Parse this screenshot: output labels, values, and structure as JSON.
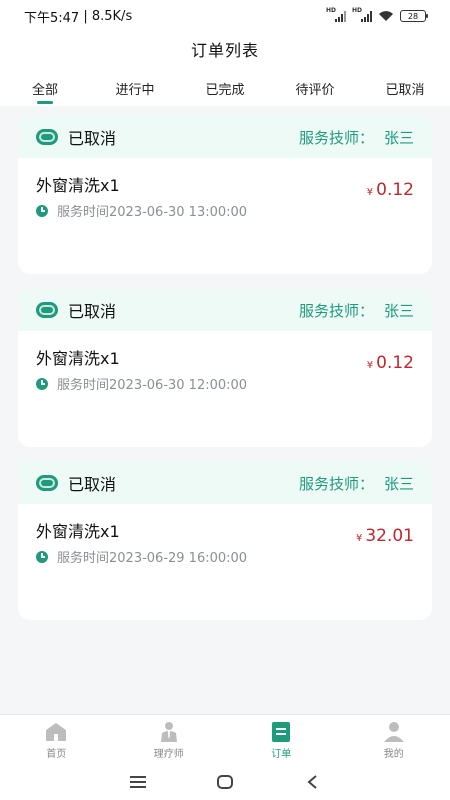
{
  "status_bar": {
    "time": "下午5:47",
    "speed": "8.5K/s",
    "battery": "28"
  },
  "header": {
    "title": "订单列表"
  },
  "tabs": [
    {
      "label": "全部"
    },
    {
      "label": "进行中"
    },
    {
      "label": "已完成"
    },
    {
      "label": "待评价"
    },
    {
      "label": "已取消"
    }
  ],
  "active_tab": "全部",
  "orders": [
    {
      "status": "已取消",
      "tech_label": "服务技师：",
      "tech_name": "张三",
      "service": "外窗清洗x1",
      "time": "服务时间2023-06-30 13:00:00",
      "currency": "¥",
      "price": "0.12"
    },
    {
      "status": "已取消",
      "tech_label": "服务技师：",
      "tech_name": "张三",
      "service": "外窗清洗x1",
      "time": "服务时间2023-06-30 12:00:00",
      "currency": "¥",
      "price": "0.12"
    },
    {
      "status": "已取消",
      "tech_label": "服务技师：",
      "tech_name": "张三",
      "service": "外窗清洗x1",
      "time": "服务时间2023-06-29 16:00:00",
      "currency": "¥",
      "price": "32.01"
    }
  ],
  "tabbar": [
    {
      "label": "首页",
      "icon": "home-icon"
    },
    {
      "label": "理疗师",
      "icon": "therapist-icon"
    },
    {
      "label": "订单",
      "icon": "order-icon"
    },
    {
      "label": "我的",
      "icon": "profile-icon"
    }
  ],
  "active_tabbar": "订单",
  "colors": {
    "accent": "#1f9a7d",
    "price": "#c0282d",
    "card_header_bg": "#eefaf5",
    "page_bg": "#f5f6f7"
  }
}
